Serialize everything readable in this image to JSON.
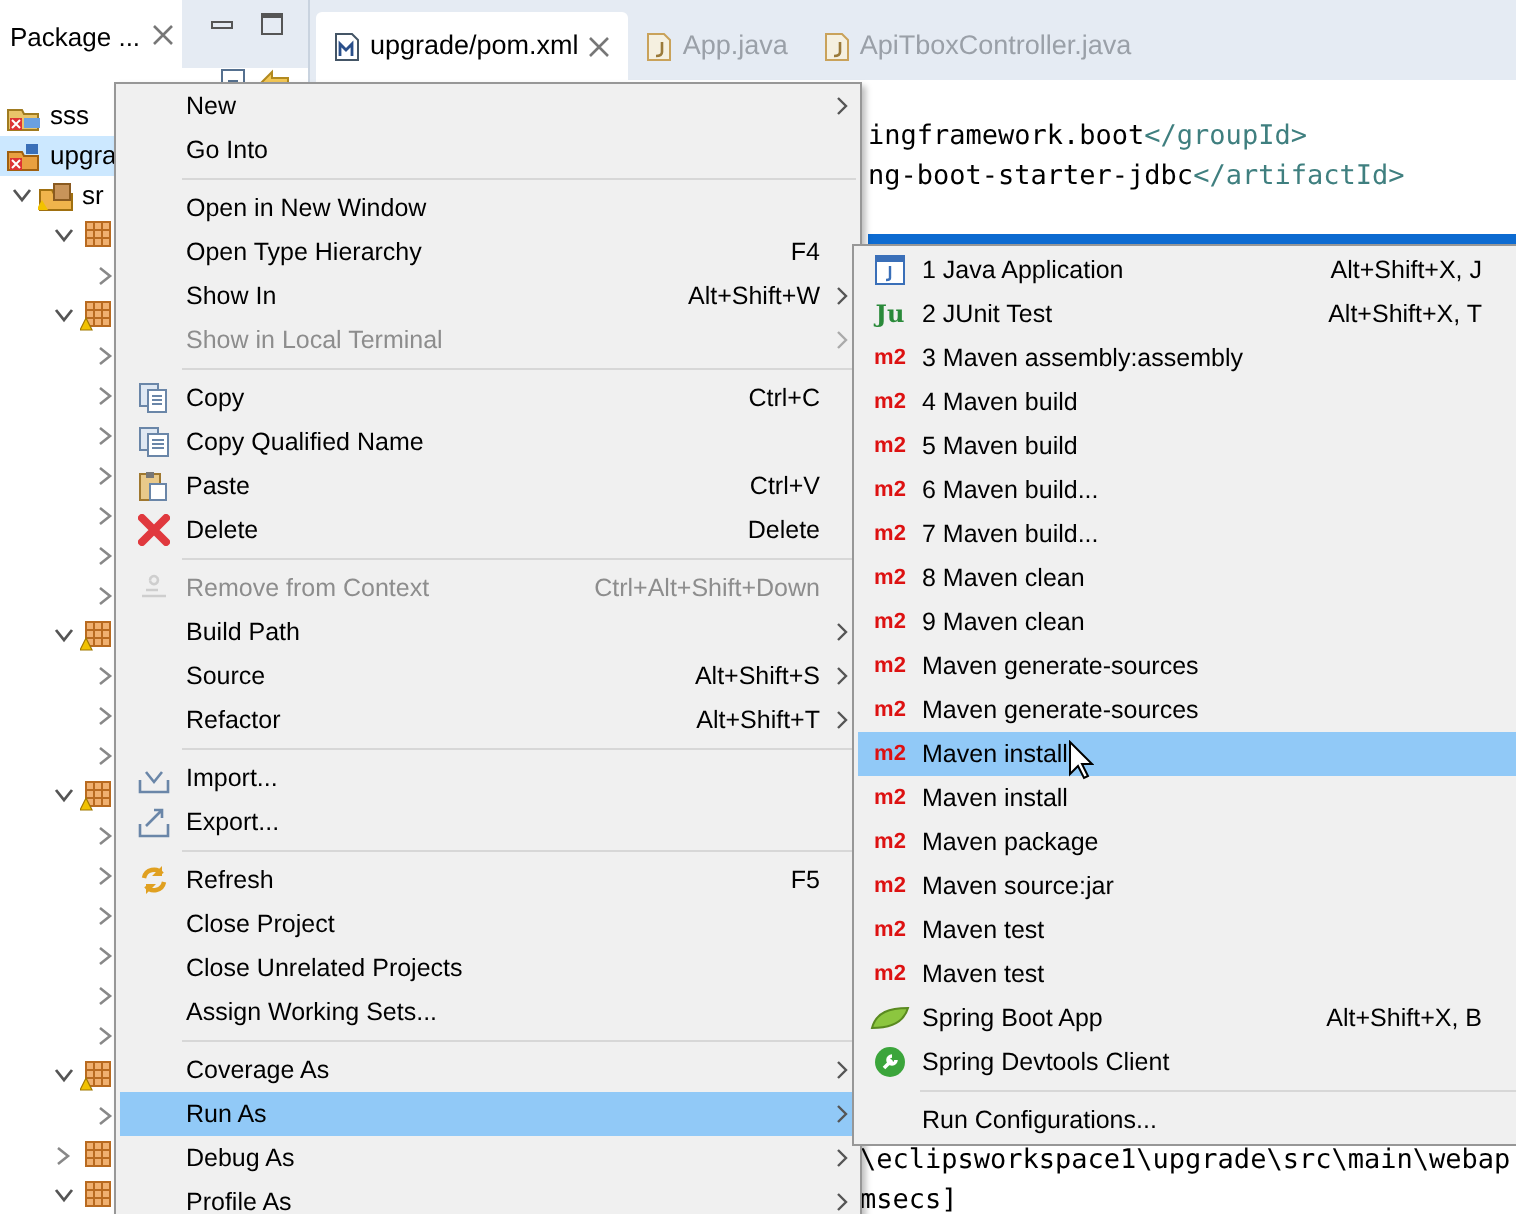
{
  "explorer": {
    "title": "Package ...",
    "tree": [
      {
        "kind": "java-project",
        "label": "sss",
        "selected": false
      },
      {
        "kind": "maven-project",
        "label": "upgra",
        "selected": true,
        "children": [
          {
            "kind": "source-folder",
            "label": "sr",
            "selected": false,
            "expanded": true,
            "children": [
              {
                "kind": "package",
                "warning": false,
                "selected": false,
                "expanded": true,
                "children": [
                  {
                    "selected": false,
                    "expanded": false
                  }
                ]
              },
              {
                "kind": "package",
                "warning": true,
                "selected": false,
                "expanded": true,
                "children": [
                  {
                    "selected": false,
                    "expanded": false
                  },
                  {
                    "selected": false,
                    "expanded": false
                  },
                  {
                    "selected": false,
                    "expanded": false
                  },
                  {
                    "selected": false,
                    "expanded": false
                  },
                  {
                    "selected": false,
                    "expanded": false
                  },
                  {
                    "selected": false,
                    "expanded": false
                  },
                  {
                    "selected": false,
                    "expanded": false
                  }
                ]
              },
              {
                "kind": "package",
                "warning": true,
                "selected": false,
                "expanded": true,
                "children": [
                  {
                    "selected": false,
                    "expanded": false
                  },
                  {
                    "selected": false,
                    "expanded": false
                  },
                  {
                    "selected": false,
                    "expanded": false
                  }
                ]
              },
              {
                "kind": "package",
                "warning": true,
                "selected": false,
                "expanded": true,
                "children": [
                  {
                    "selected": false,
                    "expanded": false
                  },
                  {
                    "selected": false,
                    "expanded": false
                  },
                  {
                    "selected": false,
                    "expanded": false
                  },
                  {
                    "selected": false,
                    "expanded": false
                  },
                  {
                    "selected": false,
                    "expanded": false
                  },
                  {
                    "selected": false,
                    "expanded": false
                  }
                ]
              },
              {
                "kind": "package",
                "warning": true,
                "selected": false,
                "expanded": true,
                "children": [
                  {
                    "selected": false,
                    "expanded": false
                  }
                ]
              },
              {
                "kind": "package",
                "warning": false,
                "selected": false,
                "expanded": false
              },
              {
                "kind": "package",
                "warning": false,
                "selected": false,
                "expanded": true
              }
            ]
          }
        ]
      }
    ]
  },
  "editor": {
    "tabs": [
      {
        "label": "upgrade/pom.xml",
        "kind": "maven",
        "selected": true
      },
      {
        "label": "App.java",
        "kind": "java",
        "selected": false
      },
      {
        "label": "ApiTboxController.java",
        "kind": "java",
        "selected": false
      }
    ],
    "code": [
      {
        "text": "ingframework.boot",
        "tag": "</groupId>"
      },
      {
        "text": "ng-boot-starter-jdbc",
        "tag": "</artifactId>"
      }
    ]
  },
  "console": [
    "\\eclipsworkspace1\\upgrade\\src\\main\\webap",
    "msecs]"
  ],
  "context_menu": [
    {
      "kind": "plain",
      "label": "New",
      "submenu": true,
      "disabled": false,
      "selected": false
    },
    {
      "kind": "plain",
      "label": "Go Into",
      "submenu": false,
      "disabled": false,
      "selected": false
    },
    {
      "kind": "separator"
    },
    {
      "kind": "plain",
      "label": "Open in New Window",
      "submenu": false,
      "disabled": false,
      "selected": false
    },
    {
      "kind": "plain",
      "label": "Open Type Hierarchy",
      "shortcut": "F4",
      "submenu": false,
      "disabled": false,
      "selected": false
    },
    {
      "kind": "plain",
      "label": "Show In",
      "shortcut": "Alt+Shift+W",
      "submenu": true,
      "disabled": false,
      "selected": false
    },
    {
      "kind": "plain",
      "label": "Show in Local Terminal",
      "submenu": true,
      "disabled": true,
      "selected": false
    },
    {
      "kind": "separator"
    },
    {
      "kind": "copy",
      "label": "Copy",
      "shortcut": "Ctrl+C",
      "submenu": false,
      "disabled": false,
      "selected": false
    },
    {
      "kind": "copy-qualified",
      "label": "Copy Qualified Name",
      "submenu": false,
      "disabled": false,
      "selected": false
    },
    {
      "kind": "paste",
      "label": "Paste",
      "shortcut": "Ctrl+V",
      "submenu": false,
      "disabled": false,
      "selected": false
    },
    {
      "kind": "delete",
      "label": "Delete",
      "shortcut": "Delete",
      "submenu": false,
      "disabled": false,
      "selected": false
    },
    {
      "kind": "separator"
    },
    {
      "kind": "remove",
      "label": "Remove from Context",
      "shortcut": "Ctrl+Alt+Shift+Down",
      "submenu": false,
      "disabled": true,
      "selected": false
    },
    {
      "kind": "plain",
      "label": "Build Path",
      "submenu": true,
      "disabled": false,
      "selected": false
    },
    {
      "kind": "plain",
      "label": "Source",
      "shortcut": "Alt+Shift+S",
      "submenu": true,
      "disabled": false,
      "selected": false
    },
    {
      "kind": "plain",
      "label": "Refactor",
      "shortcut": "Alt+Shift+T",
      "submenu": true,
      "disabled": false,
      "selected": false
    },
    {
      "kind": "separator"
    },
    {
      "kind": "import",
      "label": "Import...",
      "submenu": false,
      "disabled": false,
      "selected": false
    },
    {
      "kind": "export",
      "label": "Export...",
      "submenu": false,
      "disabled": false,
      "selected": false
    },
    {
      "kind": "separator"
    },
    {
      "kind": "refresh",
      "label": "Refresh",
      "shortcut": "F5",
      "submenu": false,
      "disabled": false,
      "selected": false
    },
    {
      "kind": "plain",
      "label": "Close Project",
      "submenu": false,
      "disabled": false,
      "selected": false
    },
    {
      "kind": "plain",
      "label": "Close Unrelated Projects",
      "submenu": false,
      "disabled": false,
      "selected": false
    },
    {
      "kind": "plain",
      "label": "Assign Working Sets...",
      "submenu": false,
      "disabled": false,
      "selected": false
    },
    {
      "kind": "separator"
    },
    {
      "kind": "plain",
      "label": "Coverage As",
      "submenu": true,
      "disabled": false,
      "selected": false
    },
    {
      "kind": "plain",
      "label": "Run As",
      "submenu": true,
      "disabled": false,
      "selected": true
    },
    {
      "kind": "plain",
      "label": "Debug As",
      "submenu": true,
      "disabled": false,
      "selected": false
    },
    {
      "kind": "plain",
      "label": "Profile As",
      "submenu": true,
      "disabled": false,
      "selected": false
    }
  ],
  "run_as_menu": [
    {
      "kind": "java-app",
      "label": "1 Java Application",
      "shortcut": "Alt+Shift+X, J",
      "selected": false
    },
    {
      "kind": "junit",
      "icon_text": "Ju",
      "label": "2 JUnit Test",
      "shortcut": "Alt+Shift+X, T",
      "selected": false
    },
    {
      "kind": "maven",
      "icon_text": "m2",
      "label": "3 Maven assembly:assembly",
      "selected": false
    },
    {
      "kind": "maven",
      "icon_text": "m2",
      "label": "4 Maven build",
      "selected": false
    },
    {
      "kind": "maven",
      "icon_text": "m2",
      "label": "5 Maven build",
      "selected": false
    },
    {
      "kind": "maven",
      "icon_text": "m2",
      "label": "6 Maven build...",
      "selected": false
    },
    {
      "kind": "maven",
      "icon_text": "m2",
      "label": "7 Maven build...",
      "selected": false
    },
    {
      "kind": "maven",
      "icon_text": "m2",
      "label": "8 Maven clean",
      "selected": false
    },
    {
      "kind": "maven",
      "icon_text": "m2",
      "label": "9 Maven clean",
      "selected": false
    },
    {
      "kind": "maven",
      "icon_text": "m2",
      "label": "Maven generate-sources",
      "selected": false
    },
    {
      "kind": "maven",
      "icon_text": "m2",
      "label": "Maven generate-sources",
      "selected": false
    },
    {
      "kind": "maven",
      "icon_text": "m2",
      "label": "Maven install",
      "selected": true
    },
    {
      "kind": "maven",
      "icon_text": "m2",
      "label": "Maven install",
      "selected": false
    },
    {
      "kind": "maven",
      "icon_text": "m2",
      "label": "Maven package",
      "selected": false
    },
    {
      "kind": "maven",
      "icon_text": "m2",
      "label": "Maven source:jar",
      "selected": false
    },
    {
      "kind": "maven",
      "icon_text": "m2",
      "label": "Maven test",
      "selected": false
    },
    {
      "kind": "maven",
      "icon_text": "m2",
      "label": "Maven test",
      "selected": false
    },
    {
      "kind": "spring-boot",
      "label": "Spring Boot App",
      "shortcut": "Alt+Shift+X, B",
      "selected": false
    },
    {
      "kind": "spring-devtools",
      "label": "Spring Devtools Client",
      "selected": false
    },
    {
      "kind": "separator"
    },
    {
      "kind": "plain",
      "label": "Run Configurations...",
      "selected": false
    }
  ]
}
